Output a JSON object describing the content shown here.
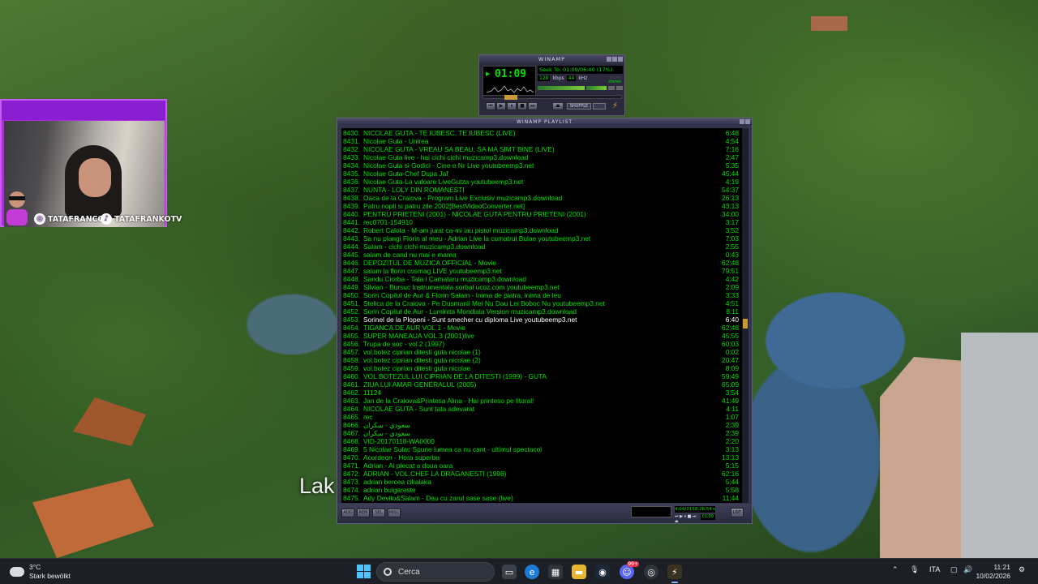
{
  "overlay": {
    "caption": "Lak",
    "instagram_handle": "TATAFRANCOO",
    "tiktok_handle": "TATAFRANKOTV"
  },
  "winamp": {
    "title": "WINAMP",
    "time": "01:09",
    "seek_text": "Seek To: 01:09/06:40 (17%)",
    "bitrate": "128",
    "kbps_label": "kbps",
    "samplerate": "44",
    "khz_label": "kHz",
    "mono_label": "mono",
    "stereo_label": "stereo",
    "seek_fraction": 0.17,
    "shuffle_label": "SHUFFLE"
  },
  "playlist": {
    "title": "WINAMP PLAYLIST",
    "selected_index": 23,
    "items": [
      {
        "n": "8430.",
        "title": "NICOLAE GUTA - TE IUBESC, TE IUBESC (LIVE)",
        "dur": "6:48"
      },
      {
        "n": "8431.",
        "title": "Nicolae Guta - Unirea",
        "dur": "4:54"
      },
      {
        "n": "8432.",
        "title": "NICOLAE GUTA - VREAU SA BEAU, SA MA SIMT BINE (LIVE)",
        "dur": "7:16"
      },
      {
        "n": "8433.",
        "title": "Nicolae Guta live - hai cichi cichi muzicamp3.download",
        "dur": "2:47"
      },
      {
        "n": "8434.",
        "title": "Nicolae Guta si Godici - Cine e Nr Live youtubeemp3.net",
        "dur": "5:35"
      },
      {
        "n": "8435.",
        "title": "Nicolae Guta-Chef Dupa Jaf",
        "dur": "45:44"
      },
      {
        "n": "8436.",
        "title": "Nicolae Guta-La valoare  LiveGutza youtubeemp3.net",
        "dur": "4:19"
      },
      {
        "n": "8437.",
        "title": "NUNTA - LOLY DIN ROMANESTI",
        "dur": "54:37"
      },
      {
        "n": "8438.",
        "title": "Oaca de la Craiova - Program Live  Exclusiv muzicamp3.download",
        "dur": "26:13"
      },
      {
        "n": "8439.",
        "title": "Patru nopti si patru zile 2002[BestVideoConverter.net]",
        "dur": "43:13"
      },
      {
        "n": "8440.",
        "title": "PENTRU PRIETENI  (2001) - NICOLAE GUTA PENTRU PRIETENI  (2001)",
        "dur": "34:00"
      },
      {
        "n": "8441.",
        "title": "rec0701-154910",
        "dur": "3:17"
      },
      {
        "n": "8442.",
        "title": "Robert Calota - M-am jurat ca-mi iau pistol muzicamp3.download",
        "dur": "3:52"
      },
      {
        "n": "8443.",
        "title": "Sa nu plangi Florin al meu - Adrian Live la cumatrul Bulae youtubeemp3.net",
        "dur": "7:03"
      },
      {
        "n": "8444.",
        "title": "Salam - cichi cichi muzicamp3.download",
        "dur": "2:55"
      },
      {
        "n": "8445.",
        "title": "salam de cand nu mai e mama",
        "dur": "0:43"
      },
      {
        "n": "8446.",
        "title": "DEPOZITUL DE MUZICA OFFICIAL - Movie",
        "dur": "62:48"
      },
      {
        "n": "8447.",
        "title": "salam la florin cosmag LIVE youtubeemp3.net",
        "dur": "79:51"
      },
      {
        "n": "8448.",
        "title": "Sandu Ciorba - Tata i Camataru muzicamp3.download",
        "dur": "4:42"
      },
      {
        "n": "8449.",
        "title": "Silvian - Bursuc  Instrumentala    sorbal ucoz.com youtubeemp3.net",
        "dur": "2:09"
      },
      {
        "n": "8450.",
        "title": "Sorin Copilul de Aur & Florin Salam - Inima de piatra, inima de leu",
        "dur": "3:33"
      },
      {
        "n": "8451.",
        "title": "Stelica de la Craiova - Pe Dusmanii Mei Nu Dau  Lei Boboc Nu youtubeemp3.net",
        "dur": "4:51"
      },
      {
        "n": "8452.",
        "title": "Sorin Copilul de Aur - Luminita Mondiala Version muzicamp3.download",
        "dur": "8:11"
      },
      {
        "n": "8453.",
        "title": "Sorinel de la Plopeni - Sunt smecher cu diploma Live youtubeemp3.net",
        "dur": "6:40"
      },
      {
        "n": "8454.",
        "title": "TIGANCA DE AUR VOL 1 - Movie",
        "dur": "62:48"
      },
      {
        "n": "8455.",
        "title": "SUPER MANEAUA VOL 3  (2001)live",
        "dur": "45:55"
      },
      {
        "n": "8456.",
        "title": "Trupa de soc - vol.2 (1997)",
        "dur": "60:03"
      },
      {
        "n": "8457.",
        "title": "vol.botez ciprian ditesti guta nicolae (1)",
        "dur": "0:02"
      },
      {
        "n": "8458.",
        "title": "vol.botez ciprian ditesti guta nicolae (2)",
        "dur": "20:47"
      },
      {
        "n": "8459.",
        "title": "vol.botez ciprian ditesti guta nicolae",
        "dur": "8:09"
      },
      {
        "n": "8460.",
        "title": "VOL.BOTEZUL LUI CIPRIAN DE LA DITESTI (1999) - GUTA",
        "dur": "59:49"
      },
      {
        "n": "8461.",
        "title": "ZIUA LUI AMAR GENERALUL (2005)",
        "dur": "65:09"
      },
      {
        "n": "8462.",
        "title": "11124",
        "dur": "3:54"
      },
      {
        "n": "8463.",
        "title": "Jan de la Craiova&Printesa Alina - Hai printeso pe litoral!",
        "dur": "41:49"
      },
      {
        "n": "8464.",
        "title": "NICOLAE GUTA - Sunt tata adevarat",
        "dur": "4:11"
      },
      {
        "n": "8465.",
        "title": "rec",
        "dur": "1:07"
      },
      {
        "n": "8466.",
        "title": "سعودي - سكران",
        "dur": "2:39"
      },
      {
        "n": "8467.",
        "title": "سعودي - سكران",
        "dur": "2:39"
      },
      {
        "n": "8468.",
        "title": "VID-20170118-WA0000",
        "dur": "2:20"
      },
      {
        "n": "8469.",
        "title": "5  Nicolae Sulac  Spune lumea ca nu cant - ultimul spectacol",
        "dur": "3:13"
      },
      {
        "n": "8470.",
        "title": "Acordeon - Hora superba",
        "dur": "13:13"
      },
      {
        "n": "8471.",
        "title": "Adrian - Ai plecat a doua oara",
        "dur": "5:15"
      },
      {
        "n": "8472.",
        "title": "ADRIAN - VOL.CHEF LA DRAGANESTI (1998)",
        "dur": "62:16"
      },
      {
        "n": "8473.",
        "title": "adrian bercea cikalaka",
        "dur": "5:44"
      },
      {
        "n": "8474.",
        "title": "adrian bulgareste",
        "dur": "5:58"
      },
      {
        "n": "8475.",
        "title": "Ady Devito&Salam - Dau cu zarul sase sase (live)",
        "dur": "11:44"
      }
    ],
    "buttons": [
      "ADD",
      "REM",
      "SEL",
      "MISC"
    ],
    "list_opts_label": "LIST",
    "total_time": "4:04/2158:28:54+",
    "mini_time": "01:09"
  },
  "taskbar": {
    "weather_temp": "3°C",
    "weather_desc": "Stark bewölkt",
    "search_label": "Cerca",
    "language": "ITA",
    "time": "11:21",
    "date": "10/02/2026",
    "discord_badge": "99+"
  }
}
